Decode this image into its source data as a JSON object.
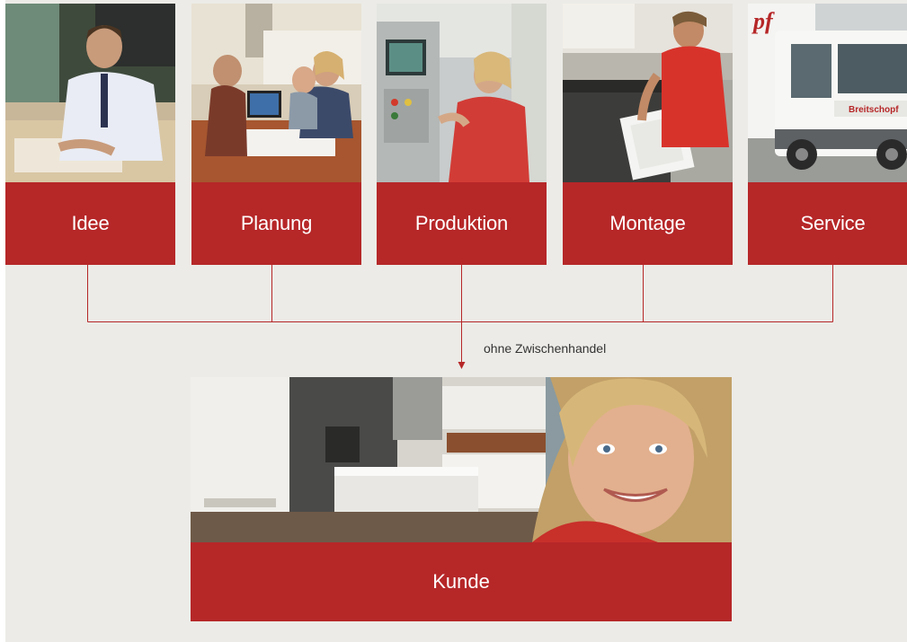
{
  "steps": [
    {
      "label": "Idee",
      "image": "person-reviewing-plans-photo"
    },
    {
      "label": "Planung",
      "image": "planning-meeting-photo"
    },
    {
      "label": "Produktion",
      "image": "machine-operator-photo"
    },
    {
      "label": "Montage",
      "image": "kitchen-installer-photo"
    },
    {
      "label": "Service",
      "image": "delivery-truck-photo"
    }
  ],
  "flow_note": "ohne Zwischenhandel",
  "result": {
    "label": "Kunde",
    "image": "kitchen-and-smiling-woman-photo"
  },
  "colors": {
    "accent": "#b62728",
    "background": "#ecebe7",
    "line": "#b62728"
  }
}
